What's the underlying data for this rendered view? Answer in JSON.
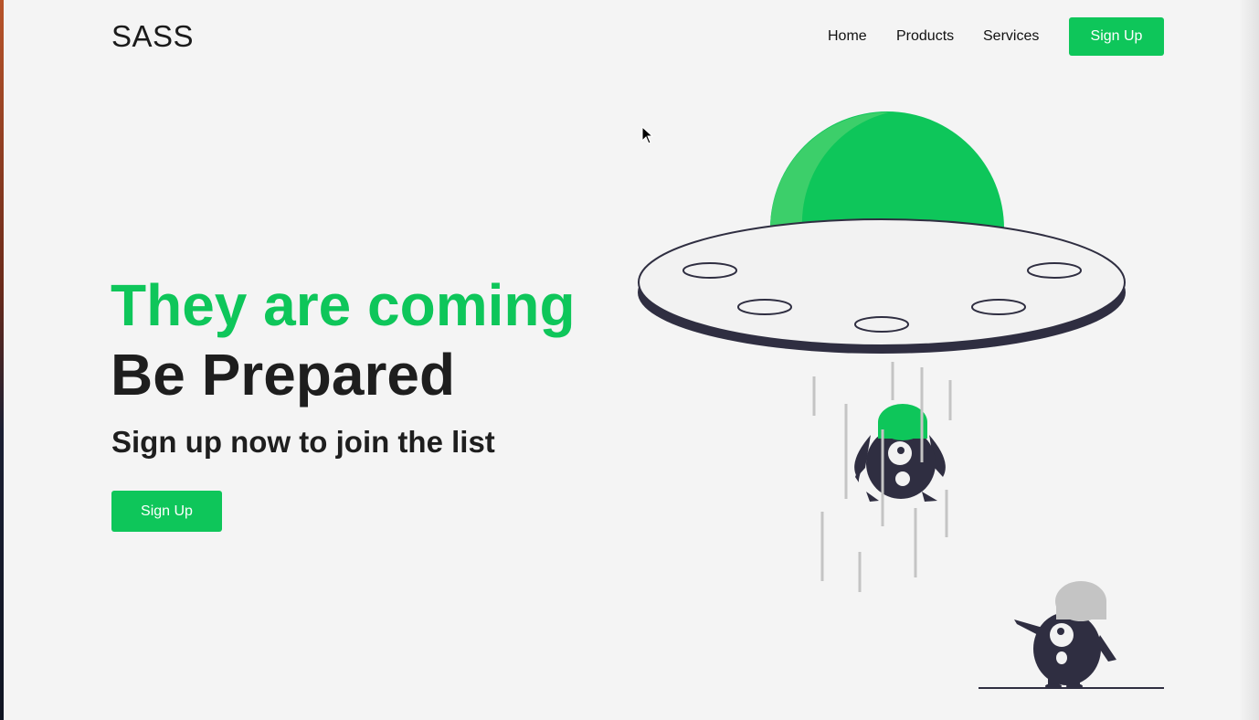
{
  "header": {
    "logo": "SASS",
    "nav": {
      "home": "Home",
      "products": "Products",
      "services": "Services",
      "signup": "Sign Up"
    }
  },
  "hero": {
    "headline_green": "They are coming",
    "headline_dark": "Be Prepared",
    "subline": "Sign up now to join the list",
    "cta": "Sign Up"
  },
  "illustration": {
    "subject": "ufo-abducting-alien-illustration",
    "colors": {
      "accent": "#0ec65a",
      "accent_light": "#3ccf6a",
      "dark": "#2f2e41",
      "beam": "#c4c4c4",
      "saucer": "#f2f2f2"
    }
  },
  "colors": {
    "brand": "#0ec65a",
    "text": "#1e1e1e",
    "background": "#f4f4f4"
  }
}
